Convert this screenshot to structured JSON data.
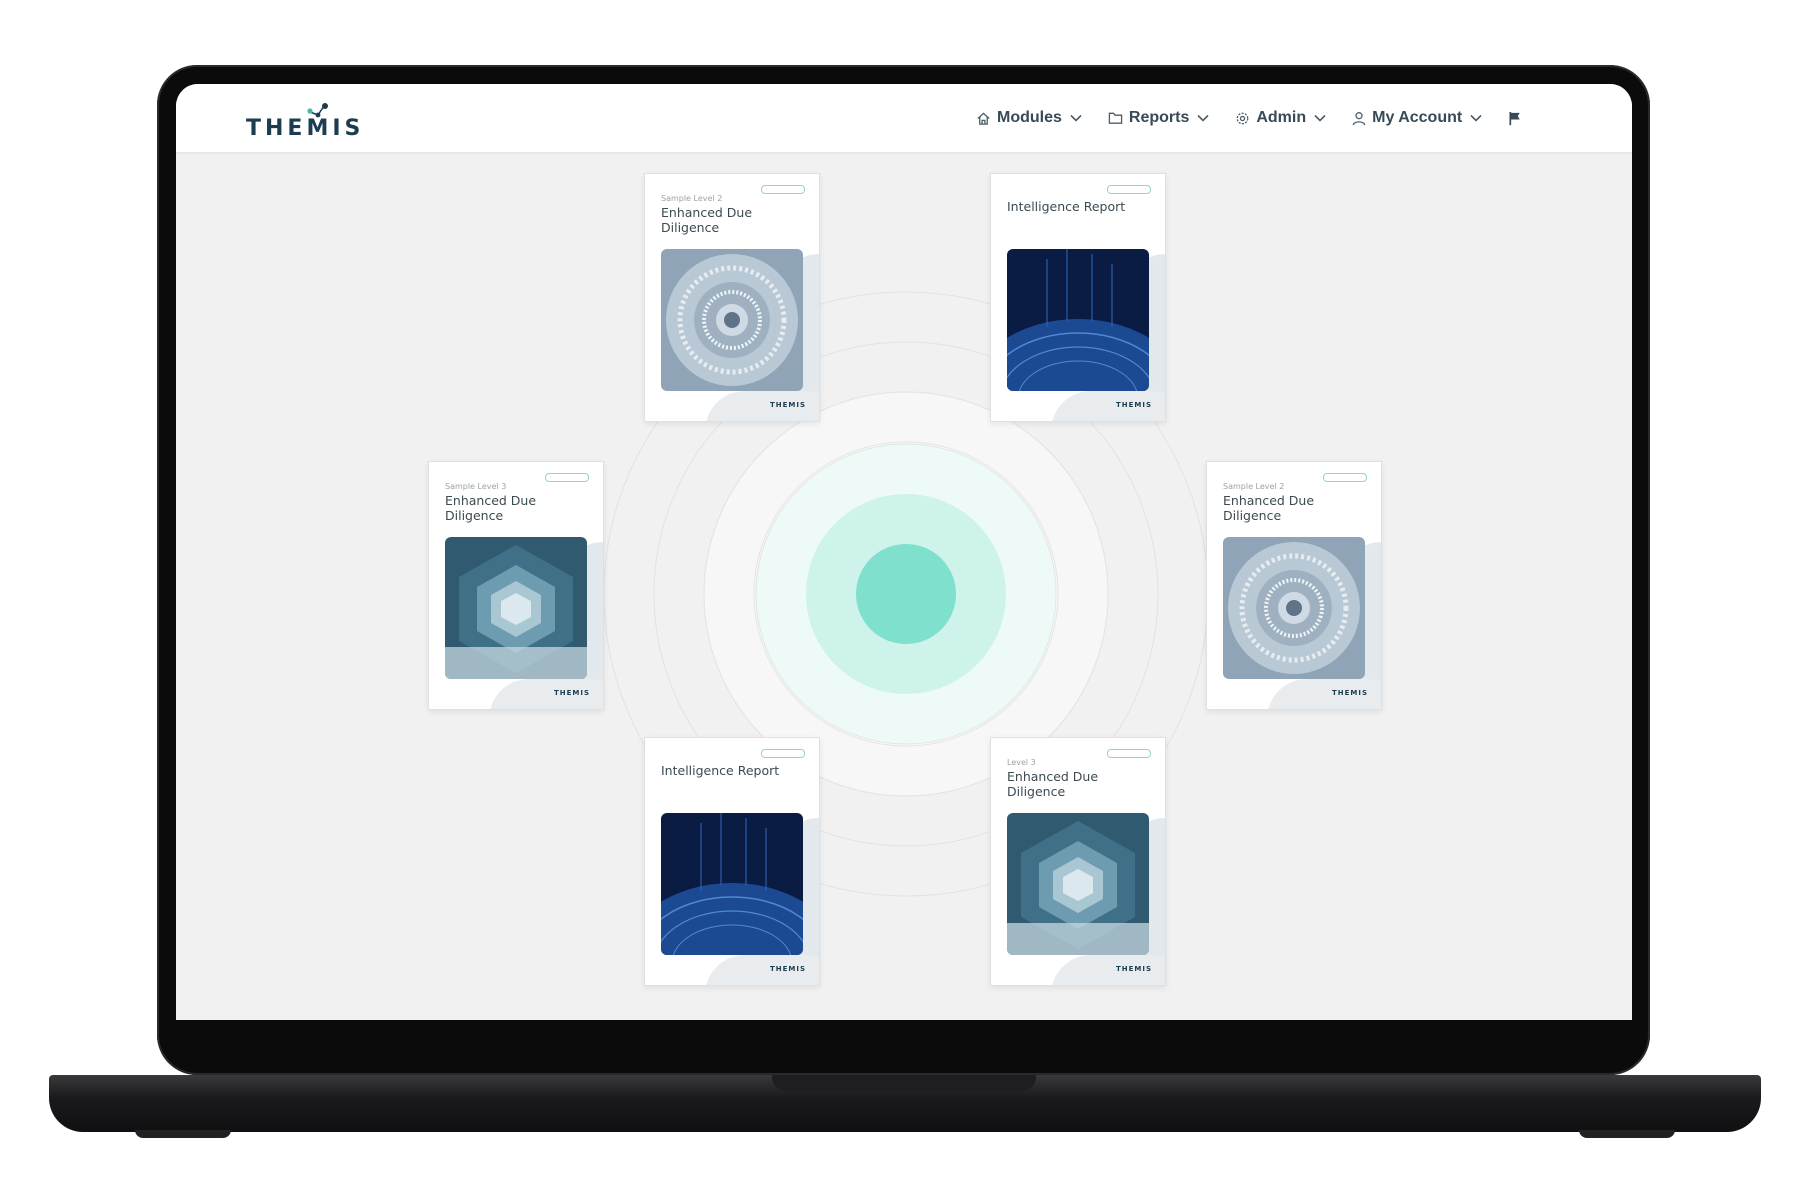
{
  "app": {
    "brand": "THEMIS"
  },
  "nav": {
    "items": [
      {
        "label": "Modules",
        "icon": "home-icon"
      },
      {
        "label": "Reports",
        "icon": "folder-icon"
      },
      {
        "label": "Admin",
        "icon": "gear-icon"
      },
      {
        "label": "My Account",
        "icon": "user-icon"
      }
    ],
    "flag_icon": "flag-icon"
  },
  "colors": {
    "brand_navy": "#1c3c4f",
    "accent_teal": "#7ee0cd",
    "ring_light": "#cdf3ea",
    "ring_lighter": "#eefaf7"
  },
  "cards": [
    {
      "eyebrow": "Sample Level 2",
      "title": "Enhanced Due Diligence",
      "image": "spiral-staircase-image",
      "brand": "THEMIS"
    },
    {
      "eyebrow": "",
      "title": "Intelligence Report",
      "image": "digital-globe-image",
      "brand": "THEMIS"
    },
    {
      "eyebrow": "Sample Level 3",
      "title": "Enhanced Due Diligence",
      "image": "hexagon-staircase-image",
      "brand": "THEMIS"
    },
    {
      "eyebrow": "Sample Level 2",
      "title": "Enhanced Due Diligence",
      "image": "spiral-staircase-image",
      "brand": "THEMIS"
    },
    {
      "eyebrow": "",
      "title": "Intelligence Report",
      "image": "digital-globe-image",
      "brand": "THEMIS"
    },
    {
      "eyebrow": "Level 3",
      "title": "Enhanced Due Diligence",
      "image": "hexagon-staircase-image",
      "brand": "THEMIS"
    }
  ]
}
